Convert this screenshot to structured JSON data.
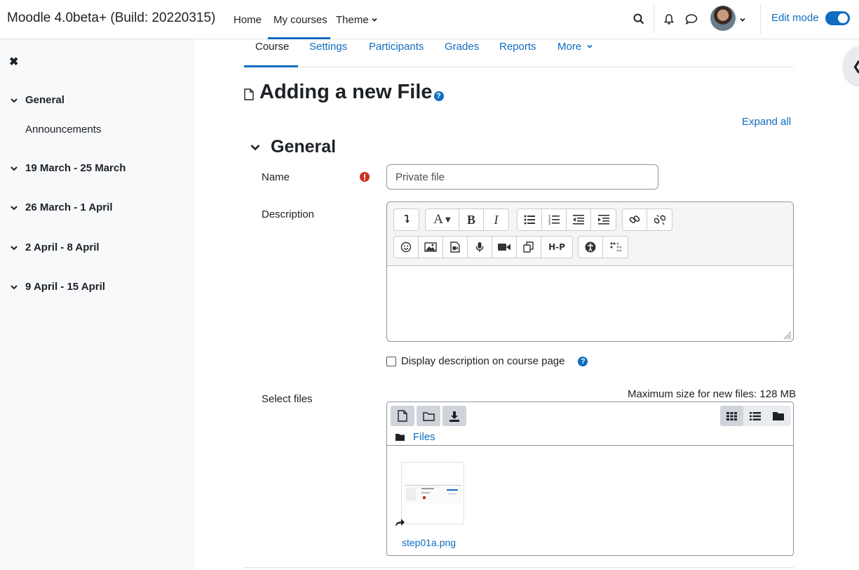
{
  "navbar": {
    "brand": "Moodle 4.0beta+ (Build: 20220315)",
    "items": [
      {
        "label": "Home"
      },
      {
        "label": "My courses"
      },
      {
        "label": "Theme"
      }
    ],
    "edit_mode_label": "Edit mode",
    "edit_mode_on": true,
    "icons": [
      "search-icon",
      "bell-icon",
      "chat-icon",
      "avatar",
      "chevron-down-icon"
    ]
  },
  "drawer": {
    "close_icon": "close-icon",
    "sections": [
      {
        "label": "General",
        "expanded": true,
        "items": [
          {
            "label": "Announcements"
          }
        ]
      },
      {
        "label": "19 March - 25 March",
        "expanded": false
      },
      {
        "label": "26 March - 1 April",
        "expanded": false
      },
      {
        "label": "2 April - 8 April",
        "expanded": false
      },
      {
        "label": "9 April - 15 April",
        "expanded": false
      }
    ]
  },
  "secondary_nav": {
    "tabs": [
      {
        "label": "Course"
      },
      {
        "label": "Settings"
      },
      {
        "label": "Participants"
      },
      {
        "label": "Grades"
      },
      {
        "label": "Reports"
      },
      {
        "label": "More"
      }
    ],
    "active": "Course"
  },
  "page": {
    "title": "Adding a new File",
    "expand_all": "Expand all",
    "section_title": "General"
  },
  "form": {
    "name_label": "Name",
    "name_value": "Private file",
    "description_label": "Description",
    "display_description_label": "Display description on course page",
    "display_description_checked": false,
    "select_files_label": "Select files",
    "max_size_text": "Maximum size for new files: 128 MB"
  },
  "filemanager": {
    "path_label": "Files",
    "files": [
      {
        "name": "step01a.png"
      }
    ],
    "view": "icons"
  },
  "colors": {
    "primary": "#0f6cbf",
    "danger": "#ca3120",
    "drawer_bg": "#f8f9fa",
    "text": "#1d2125"
  }
}
